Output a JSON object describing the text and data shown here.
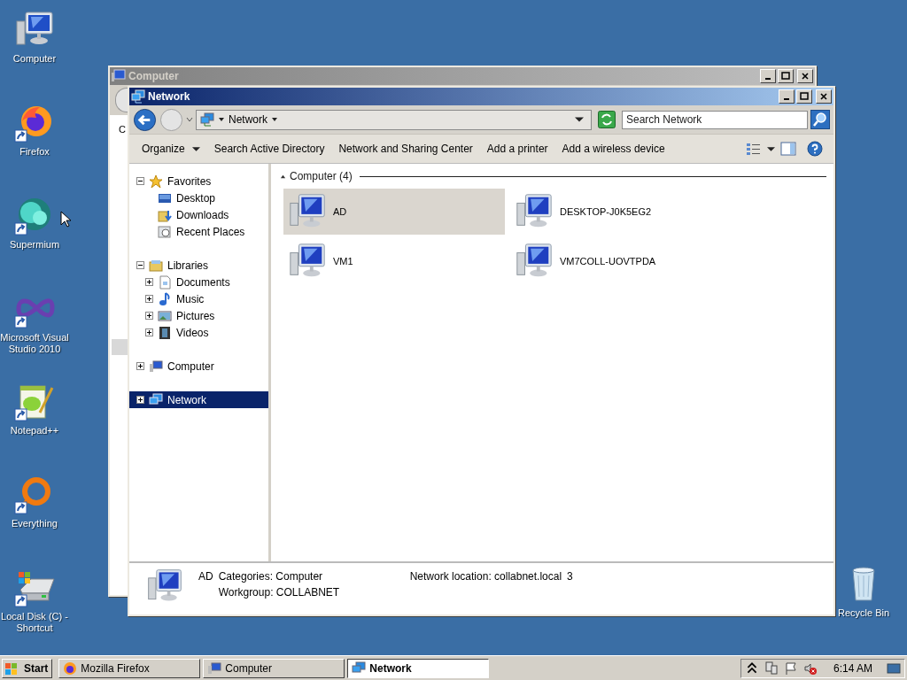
{
  "desktop_icons": [
    {
      "label": "Computer",
      "kind": "computer",
      "shortcut": false
    },
    {
      "label": "Firefox",
      "kind": "firefox",
      "shortcut": true
    },
    {
      "label": "Supermium",
      "kind": "supermium",
      "shortcut": true
    },
    {
      "label": "Microsoft Visual Studio 2010",
      "kind": "visualstudio",
      "shortcut": true
    },
    {
      "label": "Notepad++",
      "kind": "notepad",
      "shortcut": true
    },
    {
      "label": "Everything",
      "kind": "everything",
      "shortcut": true
    },
    {
      "label": "Local Disk (C) - Shortcut",
      "kind": "disk",
      "shortcut": true
    }
  ],
  "recycle_bin": {
    "label": "Recycle Bin"
  },
  "background_window": {
    "title": "Computer",
    "partial_text": "C"
  },
  "window": {
    "title": "Network",
    "address": {
      "location": "Network"
    },
    "search": {
      "placeholder": "Search Network"
    },
    "toolbar": [
      {
        "label": "Organize",
        "dropdown": true
      },
      {
        "label": "Search Active Directory",
        "dropdown": false
      },
      {
        "label": "Network and Sharing Center",
        "dropdown": false
      },
      {
        "label": "Add a printer",
        "dropdown": false
      },
      {
        "label": "Add a wireless device",
        "dropdown": false
      }
    ],
    "nav": [
      {
        "label": "Favorites",
        "kind": "star",
        "expanded": true,
        "selected": false,
        "children": [
          {
            "label": "Desktop",
            "kind": "desktop",
            "selected": false
          },
          {
            "label": "Downloads",
            "kind": "downloads",
            "selected": false
          },
          {
            "label": "Recent Places",
            "kind": "recent",
            "selected": false
          }
        ]
      },
      {
        "label": "Libraries",
        "kind": "library",
        "expanded": true,
        "selected": false,
        "children": [
          {
            "label": "Documents",
            "kind": "document",
            "expanded": false,
            "selected": false
          },
          {
            "label": "Music",
            "kind": "music",
            "expanded": false,
            "selected": false
          },
          {
            "label": "Pictures",
            "kind": "picture",
            "expanded": false,
            "selected": false
          },
          {
            "label": "Videos",
            "kind": "video",
            "expanded": false,
            "selected": false
          }
        ]
      },
      {
        "label": "Computer",
        "kind": "computer",
        "expanded": false,
        "selected": false
      },
      {
        "label": "Network",
        "kind": "network",
        "expanded": false,
        "selected": true
      }
    ],
    "group": {
      "label": "Computer (4)",
      "expanded": true
    },
    "items": [
      {
        "name": "AD",
        "selected": true
      },
      {
        "name": "DESKTOP-J0K5EG2",
        "selected": false
      },
      {
        "name": "VM1",
        "selected": false
      },
      {
        "name": "VM7COLL-UOVTPDA",
        "selected": false
      }
    ],
    "details": {
      "name": "AD",
      "fields": [
        "Categories: Computer",
        "Workgroup: COLLABNET"
      ],
      "location": "Network location: collabnet.local",
      "count": "3"
    }
  },
  "taskbar": {
    "start": "Start",
    "tasks": [
      {
        "label": "Mozilla Firefox",
        "kind": "firefox",
        "selected": false
      },
      {
        "label": "Computer",
        "kind": "computer",
        "selected": false
      },
      {
        "label": "Network",
        "kind": "network",
        "selected": true
      }
    ],
    "clock": "6:14 AM"
  }
}
